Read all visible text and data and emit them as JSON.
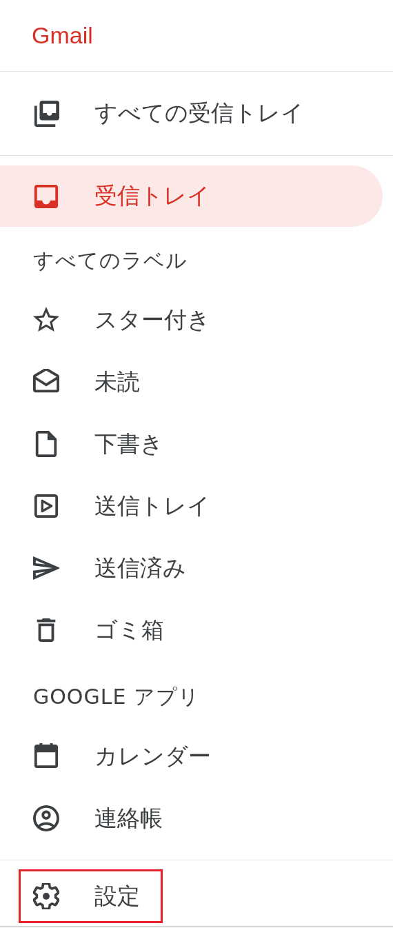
{
  "logo": "Gmail",
  "top_items": [
    {
      "label": "すべての受信トレイ",
      "selected": false
    },
    {
      "label": "受信トレイ",
      "selected": true
    }
  ],
  "labels_section": {
    "heading": "すべてのラベル",
    "items": [
      {
        "label": "スター付き",
        "selected": false
      },
      {
        "label": "未読",
        "selected": false
      },
      {
        "label": "下書き",
        "selected": false
      },
      {
        "label": "送信トレイ",
        "selected": false
      },
      {
        "label": "送信済み",
        "selected": false
      },
      {
        "label": "ゴミ箱",
        "selected": false
      }
    ]
  },
  "apps_section": {
    "heading": "GOOGLE アプリ",
    "items": [
      {
        "label": "カレンダー",
        "selected": false
      },
      {
        "label": "連絡帳",
        "selected": false
      }
    ]
  },
  "settings": {
    "label": "設定",
    "highlighted": true
  }
}
